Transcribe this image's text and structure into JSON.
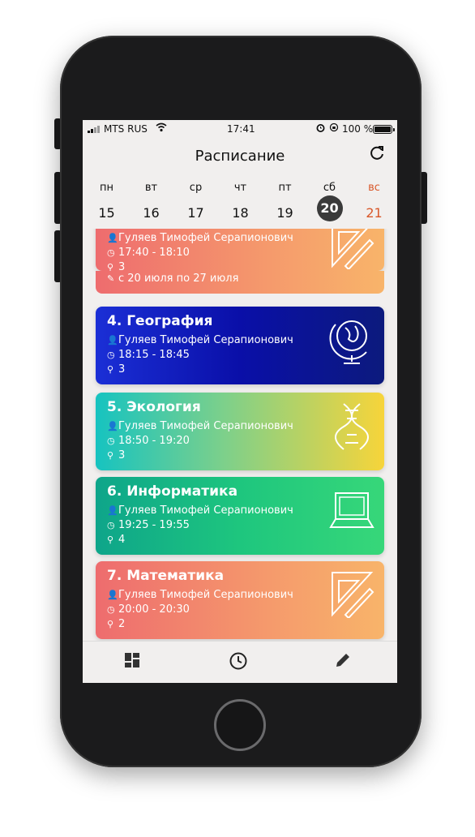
{
  "status_bar": {
    "carrier": "MTS RUS",
    "time": "17:41",
    "battery": "100 %"
  },
  "header": {
    "title": "Расписание"
  },
  "week": [
    {
      "name": "пн",
      "num": "15"
    },
    {
      "name": "вт",
      "num": "16"
    },
    {
      "name": "ср",
      "num": "17"
    },
    {
      "name": "чт",
      "num": "18"
    },
    {
      "name": "пт",
      "num": "19"
    },
    {
      "name": "сб",
      "num": "20",
      "selected": true
    },
    {
      "name": "вс",
      "num": "21",
      "weekend": true
    }
  ],
  "lessons": [
    {
      "teacher": "Гуляев Тимофей Серапионович",
      "time": "17:40 - 18:10",
      "room": "3",
      "period": "с 20 июля по 27 июля",
      "icon": "ruler-triangle-icon"
    },
    {
      "title": "4. География",
      "teacher": "Гуляев Тимофей Серапионович",
      "time": "18:15 - 18:45",
      "room": "3",
      "icon": "globe-icon"
    },
    {
      "title": "5. Экология",
      "teacher": "Гуляев Тимофей Серапионович",
      "time": "18:50 - 19:20",
      "room": "3",
      "icon": "dna-icon"
    },
    {
      "title": "6. Информатика",
      "teacher": "Гуляев Тимофей Серапионович",
      "time": "19:25 - 19:55",
      "room": "4",
      "icon": "laptop-icon"
    },
    {
      "title": "7. Математика",
      "teacher": "Гуляев Тимофей Серапионович",
      "time": "20:00 - 20:30",
      "room": "2",
      "icon": "ruler-triangle-icon"
    }
  ],
  "tabbar": [
    "dashboard-icon",
    "clock-icon",
    "pencil-icon"
  ],
  "colors": {
    "weekend": "#d9582a",
    "selected_day_bg": "#3a3a3a"
  }
}
